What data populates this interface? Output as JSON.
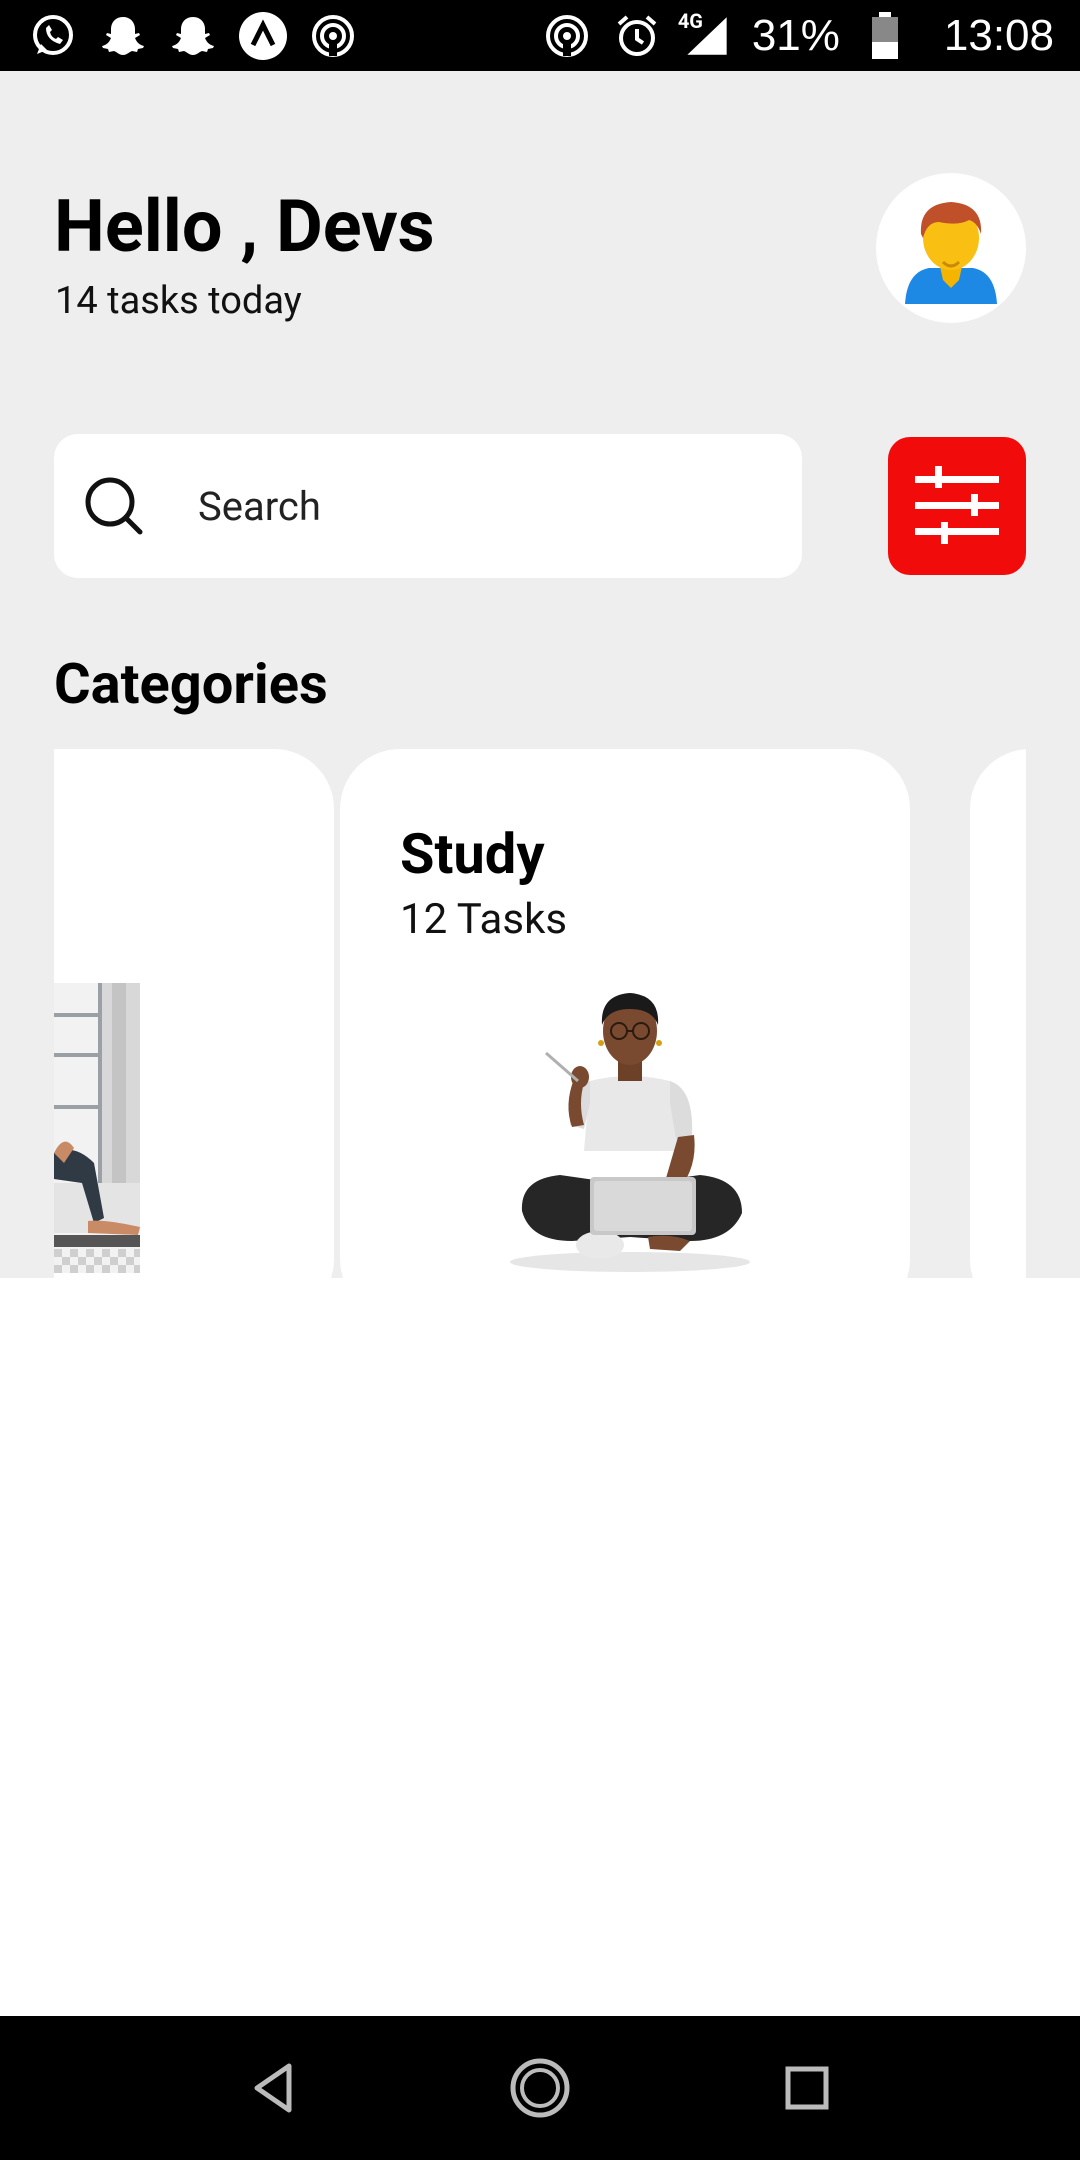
{
  "status_bar": {
    "battery": "31%",
    "time": "13:08",
    "network": "4G"
  },
  "header": {
    "greeting": "Hello , Devs",
    "subtitle": "14 tasks today"
  },
  "search": {
    "placeholder": "Search"
  },
  "categories": {
    "title": "Categories",
    "items": [
      {
        "title": "Study",
        "count": "12 Tasks"
      }
    ]
  },
  "colors": {
    "accent": "#f20b0b",
    "background": "#eeeeee"
  }
}
